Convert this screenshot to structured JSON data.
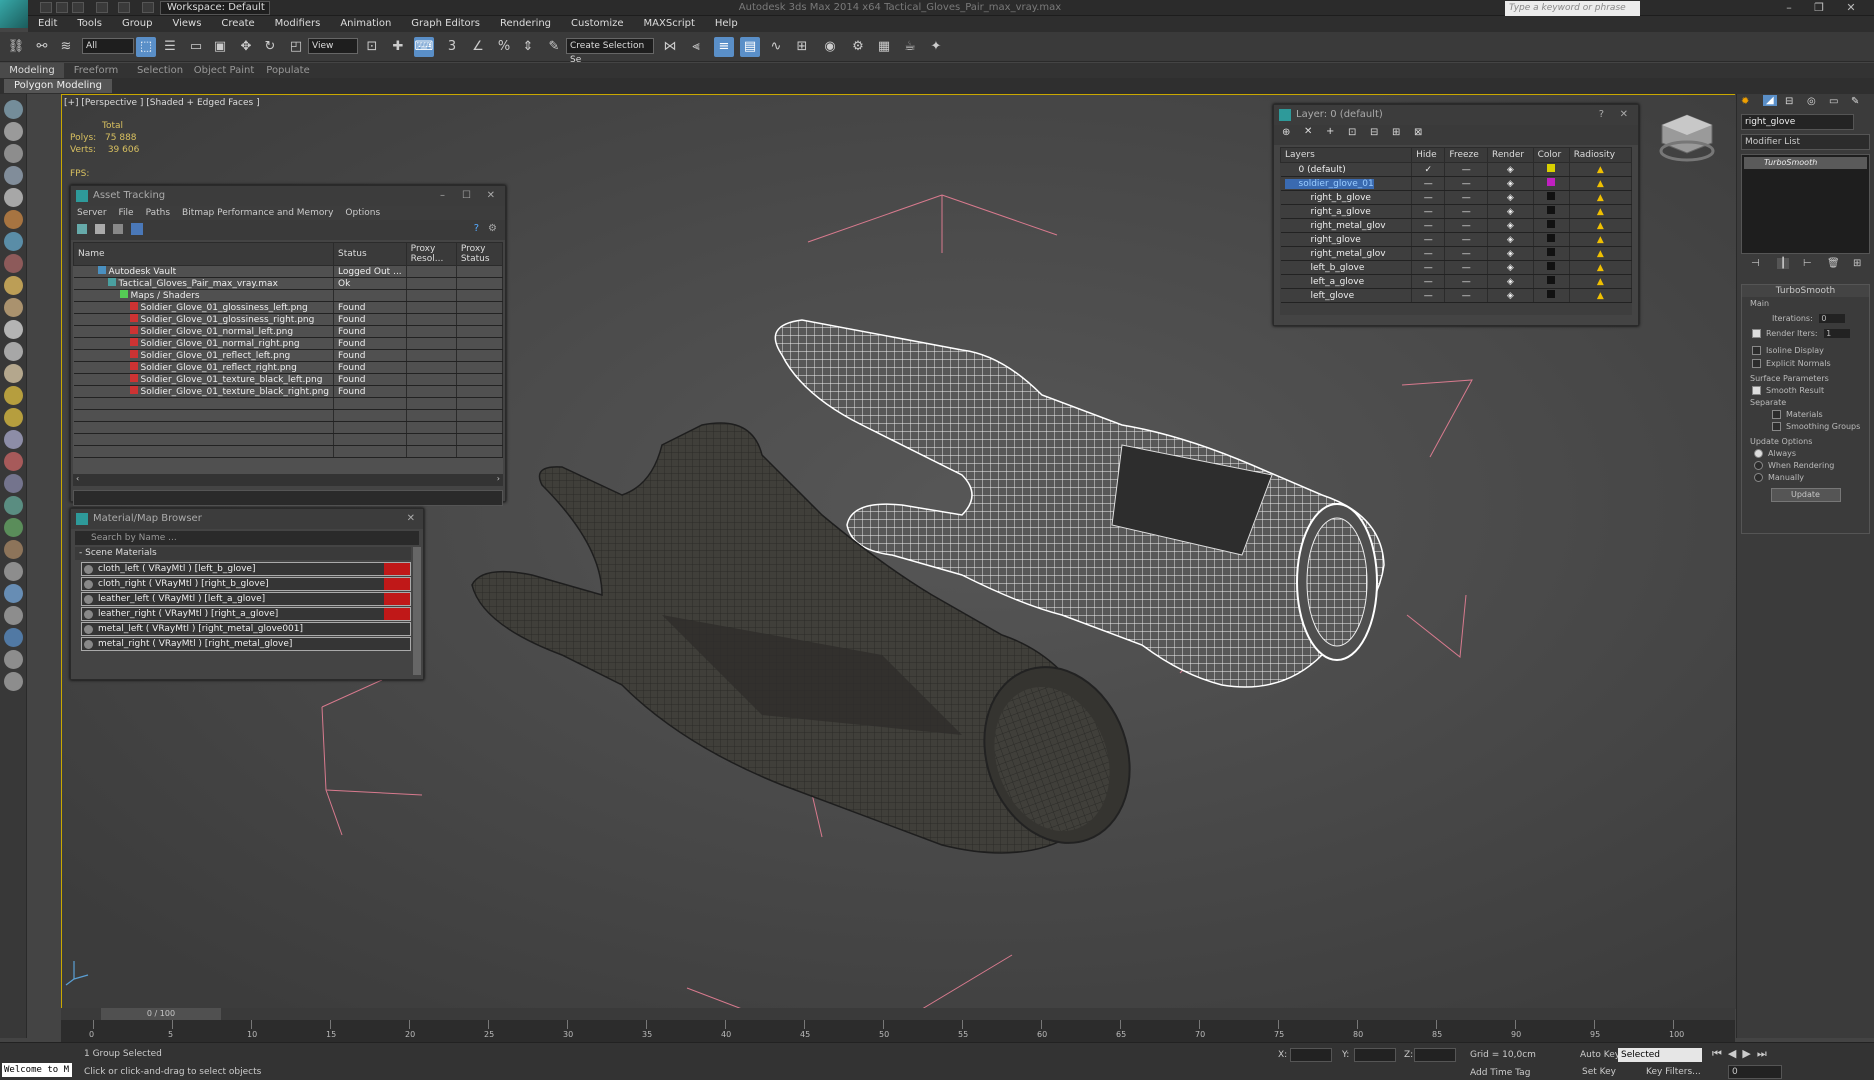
{
  "app": {
    "title": "Autodesk 3ds Max 2014 x64     Tactical_Gloves_Pair_max_vray.max",
    "workspace": "Workspace: Default",
    "search_placeholder": "Type a keyword or phrase"
  },
  "menu": [
    "Edit",
    "Tools",
    "Group",
    "Views",
    "Create",
    "Modifiers",
    "Animation",
    "Graph Editors",
    "Rendering",
    "Customize",
    "MAXScript",
    "Help"
  ],
  "toolbar": {
    "filter": "All",
    "ref_coord": "View",
    "selection_set": "Create Selection Se"
  },
  "ribbon": {
    "tabs": [
      "Modeling",
      "Freeform",
      "Selection",
      "Object Paint",
      "Populate"
    ],
    "sub": "Polygon Modeling"
  },
  "viewport": {
    "label": "[+] [Perspective ] [Shaded + Edged Faces ]",
    "total": "Total",
    "polys_label": "Polys:",
    "polys": "75 888",
    "verts_label": "Verts:",
    "verts": "39 606",
    "fps": "FPS:"
  },
  "asset": {
    "title": "Asset Tracking",
    "menu": [
      "Server",
      "File",
      "Paths",
      "Bitmap Performance and Memory",
      "Options"
    ],
    "columns": [
      "Name",
      "Status",
      "Proxy Resol...",
      "Proxy Status"
    ],
    "rows": [
      {
        "name": "Autodesk Vault",
        "status": "Logged Out ..."
      },
      {
        "name": "Tactical_Gloves_Pair_max_vray.max",
        "status": "Ok"
      },
      {
        "name": "Maps / Shaders",
        "status": ""
      },
      {
        "name": "Soldier_Glove_01_glossiness_left.png",
        "status": "Found"
      },
      {
        "name": "Soldier_Glove_01_glossiness_right.png",
        "status": "Found"
      },
      {
        "name": "Soldier_Glove_01_normal_left.png",
        "status": "Found"
      },
      {
        "name": "Soldier_Glove_01_normal_right.png",
        "status": "Found"
      },
      {
        "name": "Soldier_Glove_01_reflect_left.png",
        "status": "Found"
      },
      {
        "name": "Soldier_Glove_01_reflect_right.png",
        "status": "Found"
      },
      {
        "name": "Soldier_Glove_01_texture_black_left.png",
        "status": "Found"
      },
      {
        "name": "Soldier_Glove_01_texture_black_right.png",
        "status": "Found"
      }
    ]
  },
  "material": {
    "title": "Material/Map Browser",
    "search": "Search by Name ...",
    "section": "- Scene Materials",
    "items": [
      "cloth_left  ( VRayMtl ) [left_b_glove]",
      "cloth_right  ( VRayMtl ) [right_b_glove]",
      "leather_left  ( VRayMtl ) [left_a_glove]",
      "leather_right  ( VRayMtl ) [right_a_glove]",
      "metal_left  ( VRayMtl ) [right_metal_glove001]",
      "metal_right  ( VRayMtl ) [right_metal_glove]"
    ]
  },
  "layer": {
    "title": "Layer: 0 (default)",
    "columns": [
      "Layers",
      "Hide",
      "Freeze",
      "Render",
      "Color",
      "Radiosity"
    ],
    "rows": [
      "0 (default)",
      "soldier_glove_01",
      "right_b_glove",
      "right_a_glove",
      "right_metal_glov",
      "right_glove",
      "right_metal_glov",
      "left_b_glove",
      "left_a_glove",
      "left_glove"
    ]
  },
  "cmdpanel": {
    "object": "right_glove",
    "modlist": "Modifier List",
    "stack_item": "TurboSmooth",
    "rollout": "TurboSmooth",
    "main": "Main",
    "iterations_label": "Iterations:",
    "iterations": "0",
    "render_iters_label": "Render Iters:",
    "render_iters": "1",
    "isoline": "Isoline Display",
    "explicit": "Explicit Normals",
    "surface": "Surface Parameters",
    "smooth_result": "Smooth Result",
    "separate": "Separate",
    "materials": "Materials",
    "smoothing": "Smoothing Groups",
    "update_opts": "Update Options",
    "always": "Always",
    "when_rendering": "When Rendering",
    "manually": "Manually",
    "update_btn": "Update"
  },
  "timeline": {
    "frame": "0 / 100",
    "ticks": [
      "0",
      "5",
      "10",
      "15",
      "20",
      "25",
      "30",
      "35",
      "40",
      "45",
      "50",
      "55",
      "60",
      "65",
      "70",
      "75",
      "80",
      "85",
      "90",
      "95",
      "100"
    ]
  },
  "status": {
    "maxscript": "Welcome to M",
    "selected": "1 Group Selected",
    "prompt": "Click or click-and-drag to select objects",
    "x": "X:",
    "y": "Y:",
    "z": "Z:",
    "grid": "Grid = 10,0cm",
    "add_time_tag": "Add Time Tag",
    "auto_key": "Auto Key",
    "set_key": "Set Key",
    "selected_dd": "Selected",
    "key_filters": "Key Filters...",
    "frame_field": "0"
  }
}
